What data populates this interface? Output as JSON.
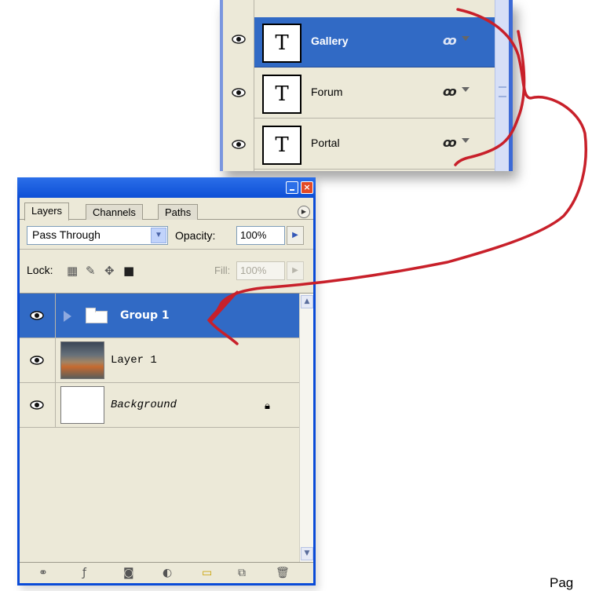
{
  "zoom_panel": {
    "layers": [
      {
        "name": "Gallery",
        "thumb_glyph": "T",
        "selected": true
      },
      {
        "name": "Forum",
        "thumb_glyph": "T",
        "selected": false
      },
      {
        "name": "Portal",
        "thumb_glyph": "T",
        "selected": false
      }
    ]
  },
  "palette": {
    "tabs": [
      "Layers",
      "Channels",
      "Paths"
    ],
    "blend_mode": "Pass Through",
    "opacity_label": "Opacity:",
    "opacity_value": "100%",
    "lock_label": "Lock:",
    "fill_label": "Fill:",
    "fill_value": "100%",
    "close_glyph": "×",
    "layers": [
      {
        "name": "Group 1",
        "type": "group",
        "selected": true
      },
      {
        "name": "Layer 1",
        "type": "image",
        "selected": false
      },
      {
        "name": "Background",
        "type": "background",
        "selected": false,
        "locked": true
      }
    ],
    "bottom_icons": [
      "link-icon",
      "layer-style-icon",
      "mask-icon",
      "adjustment-layer-icon",
      "new-group-icon",
      "new-layer-icon",
      "trash-icon"
    ]
  },
  "page_label": "Pag",
  "colors": {
    "selection_blue": "#316ac5",
    "titlebar_blue": "#0d4fd6",
    "panel_bg": "#ece9d8",
    "annotation_red": "#c8202a"
  }
}
